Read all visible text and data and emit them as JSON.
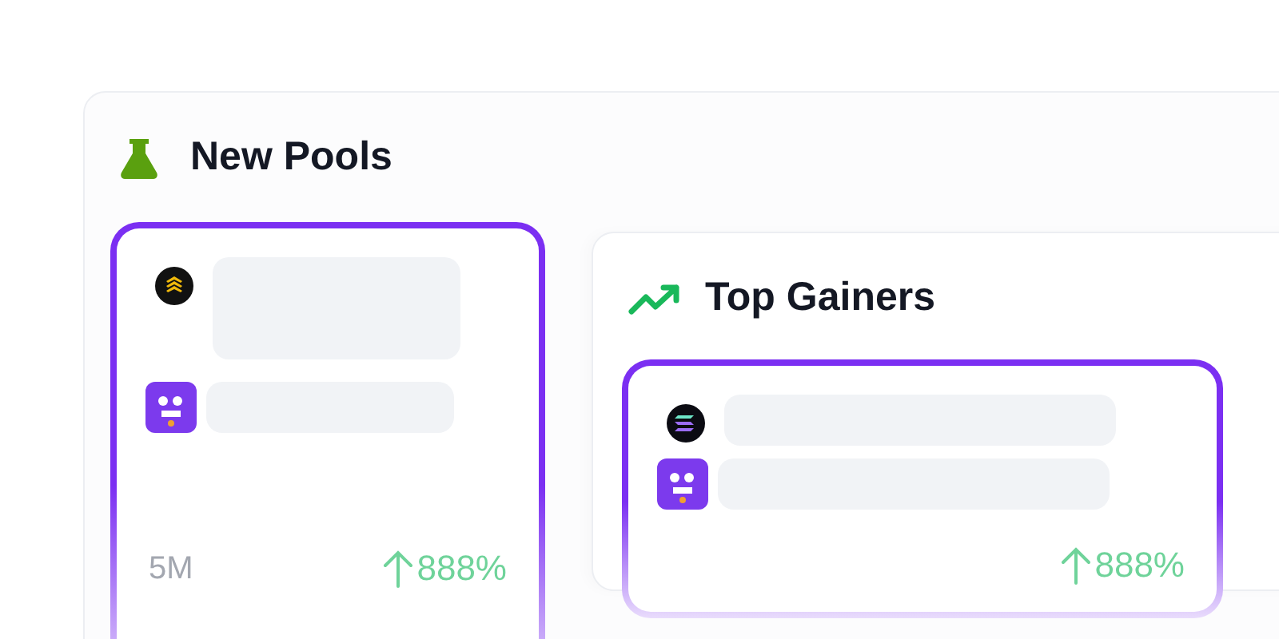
{
  "panels": [
    {
      "title": "New Pools",
      "kind": "flask",
      "cards": [
        {
          "volume": "5M",
          "change": "888%"
        }
      ]
    },
    {
      "title": "Top Gainers",
      "kind": "trend",
      "cards": [
        {
          "change": "888%"
        }
      ]
    }
  ]
}
